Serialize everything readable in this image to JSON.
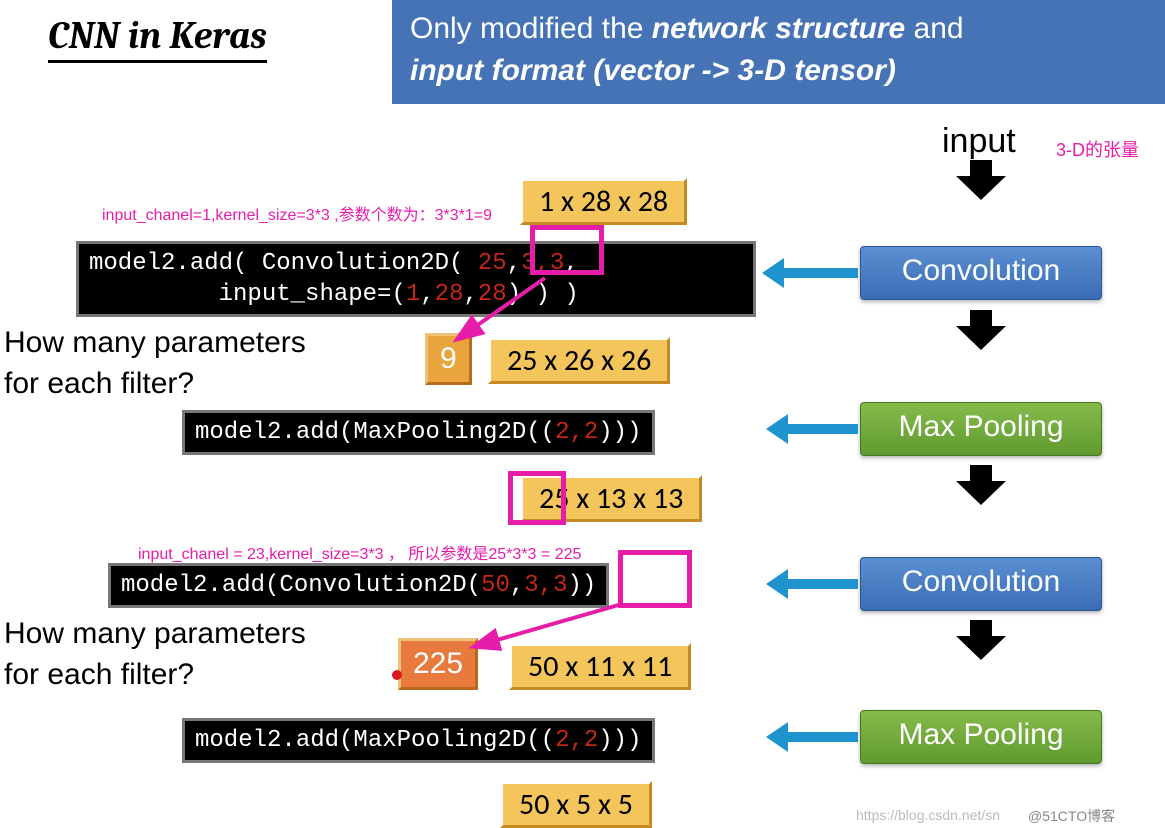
{
  "title": "CNN in Keras",
  "header": {
    "pre": "Only modified the ",
    "em1": "network structure",
    "mid": " and ",
    "em2": "input format (vector -> 3-D tensor)"
  },
  "input_label": "input",
  "tensor_note": "3-D的张量",
  "annotations": {
    "a1": "input_chanel=1,kernel_size=3*3 ,参数个数为：3*3*1=9",
    "a2": "input_chanel = 23,kernel_size=3*3 ， 所以参数是25*3*3 = 225"
  },
  "questions": {
    "q1a": "How many parameters",
    "q1b": "for each filter?",
    "q2a": "How many parameters",
    "q2b": "for each filter?"
  },
  "dims": {
    "d0": "1 x 28 x 28",
    "d1": "25 x 26 x 26",
    "d2_pre": "25",
    "d2_post": " x 13 x 13",
    "d3": "50 x 11 x 11",
    "d4": "50 x 5 x 5"
  },
  "answers": {
    "a1": "9",
    "a2": "225"
  },
  "code": {
    "c1a": "model2.add( Convolution2D( ",
    "c1_25": "25",
    "c1_c": ",",
    "c1_33": "3,3",
    "c1b": "input_shape=(",
    "c1_1": "1",
    "c1_28a": "28",
    "c1_28b": "28",
    "c1_end": ") ) )",
    "c2a": "model2.add(MaxPooling2D((",
    "c2_22": "2,2",
    "c2_end": ")))",
    "c3a": "model2.add(Convolution2D(",
    "c3_50": "50",
    "c3_c": ",",
    "c3_33": "3,3",
    "c3_end": "))",
    "c4a": "model2.add(MaxPooling2D((",
    "c4_22": "2,2",
    "c4_end": ")))"
  },
  "stages": {
    "conv": "Convolution",
    "pool": "Max Pooling"
  },
  "watermark1": "https://blog.csdn.net/sn",
  "watermark2": "@51CTO博客"
}
